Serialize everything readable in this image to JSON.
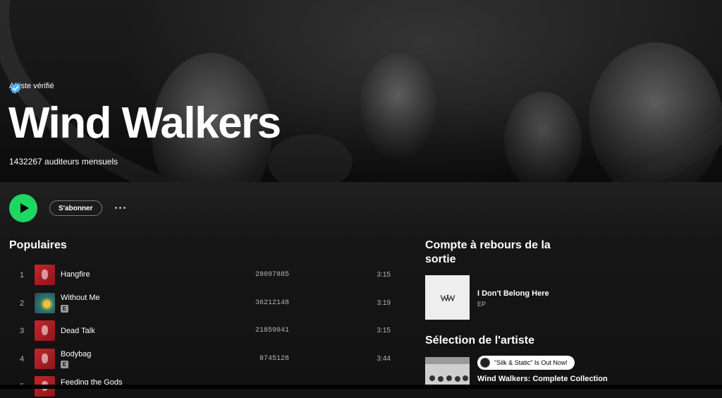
{
  "artist": {
    "verified_label": "Artiste vérifié",
    "name": "Wind Walkers",
    "monthly_listeners": "1432267 auditeurs mensuels"
  },
  "actions": {
    "follow_label": "S'abonner"
  },
  "popular": {
    "title": "Populaires",
    "tracks": [
      {
        "num": "1",
        "title": "Hangfire",
        "plays": "28097885",
        "duration": "3:15",
        "explicit": false,
        "art": "red"
      },
      {
        "num": "2",
        "title": "Without Me",
        "plays": "36212148",
        "duration": "3:19",
        "explicit": true,
        "art": "green"
      },
      {
        "num": "3",
        "title": "Dead Talk",
        "plays": "21859041",
        "duration": "3:15",
        "explicit": false,
        "art": "red"
      },
      {
        "num": "4",
        "title": "Bodybag",
        "plays": "8745128",
        "duration": "3:44",
        "explicit": true,
        "art": "red"
      },
      {
        "num": "5",
        "title": "Feeding the Gods",
        "plays": "",
        "duration": "",
        "explicit": false,
        "art": "red"
      }
    ],
    "explicit_badge": "E"
  },
  "countdown": {
    "title": "Compte à rebours de la sortie",
    "release_title": "I Don't Belong Here",
    "release_type": "EP"
  },
  "artist_pick": {
    "title": "Sélection de l'artiste",
    "pill_text": "\"Silk & Static\" Is Out Now!",
    "playlist_name": "Wind Walkers: Complete Collection"
  },
  "colors": {
    "accent": "#1ed760",
    "background": "#121212",
    "verified_badge": "#4cb3ff"
  }
}
